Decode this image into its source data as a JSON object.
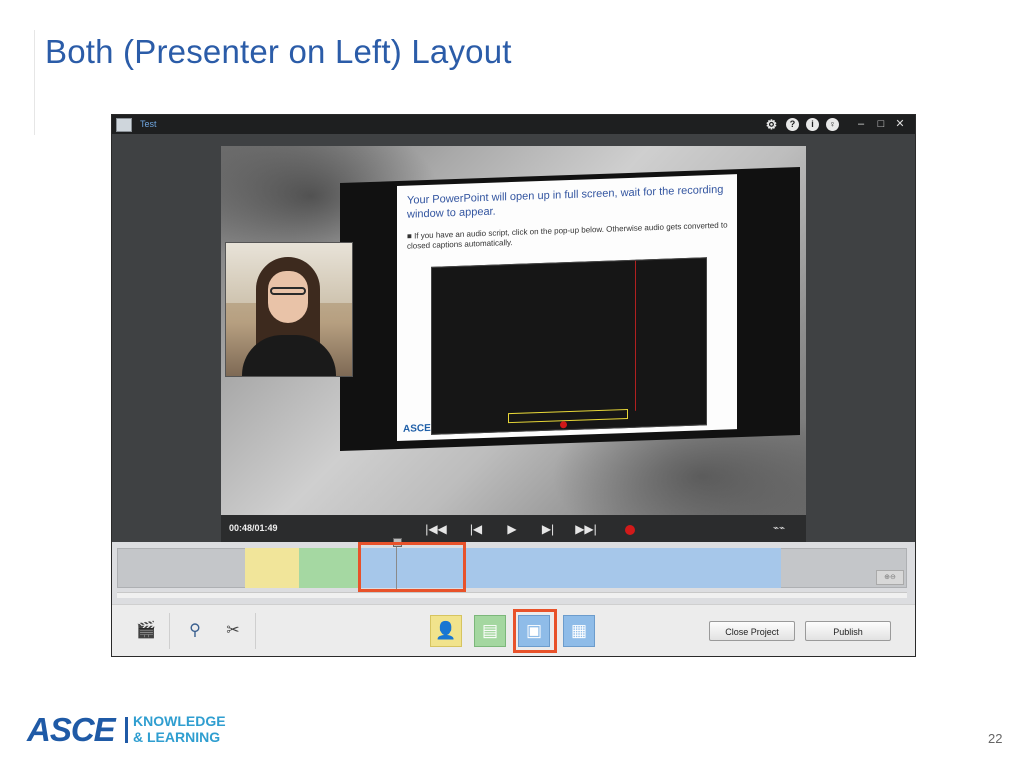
{
  "slide": {
    "title": "Both (Presenter on Left) Layout",
    "page_number": "22"
  },
  "app": {
    "icon_label": "",
    "window_title": "Test",
    "titlebar_icons": [
      "gear-icon",
      "help-icon",
      "info-icon",
      "lightbulb-icon"
    ],
    "window_controls": [
      "minimize-icon",
      "maximize-icon",
      "close-icon"
    ]
  },
  "preview": {
    "slide_heading": "Your PowerPoint will open up in full screen, wait for the recording window to appear.",
    "slide_bullet": "If you have an audio script, click on the pop-up below. Otherwise audio gets converted to closed captions automatically.",
    "slide_logo": "ASCE"
  },
  "player": {
    "time": "00:48/01:49",
    "controls": [
      "skip-to-start",
      "previous-marker",
      "play",
      "next-marker",
      "skip-to-end",
      "record",
      "closed-captions"
    ]
  },
  "timeline": {
    "segments": [
      "yellow",
      "green",
      "blue"
    ],
    "colors": {
      "yellow": "#f1e59a",
      "green": "#a5d8a2",
      "blue": "#a6c7ea",
      "highlight": "#e8522a"
    }
  },
  "toolbar": {
    "tools": [
      "clapperboard-icon",
      "zoom-icon",
      "scissors-icon"
    ],
    "layouts": [
      "presenter-only",
      "slides-only",
      "presenter-left",
      "presenter-right"
    ],
    "selected_layout": "presenter-left",
    "close_label": "Close Project",
    "publish_label": "Publish"
  },
  "footer": {
    "logo_main": "ASCE",
    "logo_line1": "KNOWLEDGE",
    "logo_line2": "& LEARNING"
  }
}
